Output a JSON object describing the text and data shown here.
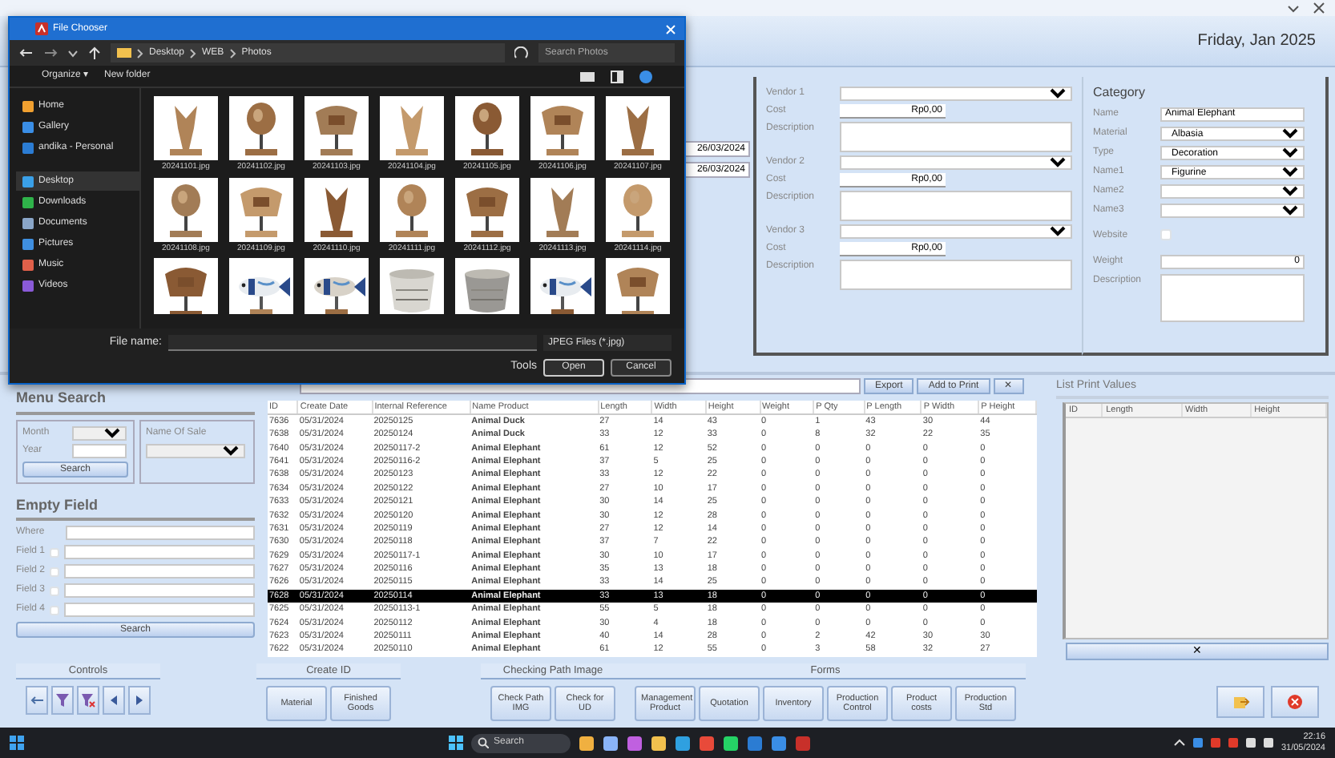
{
  "header": {
    "date": "Friday, Jan 2025"
  },
  "side_dates": [
    "26/03/2024",
    "26/03/2024"
  ],
  "vendors": [
    {
      "label": "Vendor 1",
      "cost_label": "Cost",
      "cost": "Rp0,00",
      "description_label": "Description"
    },
    {
      "label": "Vendor 2",
      "cost_label": "Cost",
      "cost": "Rp0,00",
      "description_label": "Description"
    },
    {
      "label": "Vendor 3",
      "cost_label": "Cost",
      "cost": "Rp0,00",
      "description_label": "Description"
    }
  ],
  "category": {
    "title": "Category",
    "fields": [
      {
        "label": "Name",
        "kind": "text",
        "value": "Animal Elephant"
      },
      {
        "label": "Material",
        "kind": "select",
        "value": "Albasia"
      },
      {
        "label": "Type",
        "kind": "select",
        "value": "Decoration"
      },
      {
        "label": "Name1",
        "kind": "select",
        "value": "Figurine"
      },
      {
        "label": "Name2",
        "kind": "select"
      },
      {
        "label": "Name3",
        "kind": "select"
      },
      {
        "label": "Website",
        "kind": "checkbox",
        "checked": false
      },
      {
        "label": "Weight",
        "kind": "spin",
        "value": "0"
      },
      {
        "label": "Description",
        "kind": "area"
      }
    ]
  },
  "menu_search": {
    "title": "Menu Search",
    "month_label": "Month",
    "year_label": "Year",
    "search_button": "Search",
    "name_label": "Name Of Sale"
  },
  "empty_field": {
    "title": "Empty Field",
    "where_label": "Where",
    "search_button": "Search",
    "fields": [
      {
        "label": "Field 1",
        "checked": false
      },
      {
        "label": "Field 2",
        "checked": false
      },
      {
        "label": "Field 3",
        "checked": false
      },
      {
        "label": "Field 4",
        "checked": false
      }
    ]
  },
  "table": {
    "buttons": [
      "Export",
      "Add to Print",
      "✕"
    ],
    "columns": [
      "ID",
      "Create Date",
      "Internal Reference",
      "Name Product",
      "Length",
      "Width",
      "Height",
      "Weight",
      "P Qty",
      "P Length",
      "P Width",
      "P Height"
    ],
    "rows": [
      {
        "selected": false,
        "cells": [
          "7636",
          "05/31/2024",
          "20250125",
          "Animal Duck",
          "27",
          "14",
          "43",
          "0",
          "1",
          "43",
          "30",
          "44"
        ]
      },
      {
        "selected": false,
        "cells": [
          "7638",
          "05/31/2024",
          "20250124",
          "Animal Duck",
          "33",
          "12",
          "33",
          "0",
          "8",
          "32",
          "22",
          "35"
        ]
      },
      {
        "selected": false,
        "cells": [
          "7640",
          "05/31/2024",
          "20250117-2",
          "Animal Elephant",
          "61",
          "12",
          "52",
          "0",
          "0",
          "0",
          "0",
          "0"
        ]
      },
      {
        "selected": false,
        "cells": [
          "7641",
          "05/31/2024",
          "20250116-2",
          "Animal Elephant",
          "37",
          "5",
          "25",
          "0",
          "0",
          "0",
          "0",
          "0"
        ]
      },
      {
        "selected": false,
        "cells": [
          "7638",
          "05/31/2024",
          "20250123",
          "Animal Elephant",
          "33",
          "12",
          "22",
          "0",
          "0",
          "0",
          "0",
          "0"
        ]
      },
      {
        "selected": false,
        "cells": [
          "7634",
          "05/31/2024",
          "20250122",
          "Animal Elephant",
          "27",
          "10",
          "17",
          "0",
          "0",
          "0",
          "0",
          "0"
        ]
      },
      {
        "selected": false,
        "cells": [
          "7633",
          "05/31/2024",
          "20250121",
          "Animal Elephant",
          "30",
          "14",
          "25",
          "0",
          "0",
          "0",
          "0",
          "0"
        ]
      },
      {
        "selected": false,
        "cells": [
          "7632",
          "05/31/2024",
          "20250120",
          "Animal Elephant",
          "30",
          "12",
          "28",
          "0",
          "0",
          "0",
          "0",
          "0"
        ]
      },
      {
        "selected": false,
        "cells": [
          "7631",
          "05/31/2024",
          "20250119",
          "Animal Elephant",
          "27",
          "12",
          "14",
          "0",
          "0",
          "0",
          "0",
          "0"
        ]
      },
      {
        "selected": false,
        "cells": [
          "7630",
          "05/31/2024",
          "20250118",
          "Animal Elephant",
          "37",
          "7",
          "22",
          "0",
          "0",
          "0",
          "0",
          "0"
        ]
      },
      {
        "selected": false,
        "cells": [
          "7629",
          "05/31/2024",
          "20250117-1",
          "Animal Elephant",
          "30",
          "10",
          "17",
          "0",
          "0",
          "0",
          "0",
          "0"
        ]
      },
      {
        "selected": false,
        "cells": [
          "7627",
          "05/31/2024",
          "20250116",
          "Animal Elephant",
          "35",
          "13",
          "18",
          "0",
          "0",
          "0",
          "0",
          "0"
        ]
      },
      {
        "selected": false,
        "cells": [
          "7626",
          "05/31/2024",
          "20250115",
          "Animal Elephant",
          "33",
          "14",
          "25",
          "0",
          "0",
          "0",
          "0",
          "0"
        ]
      },
      {
        "selected": true,
        "cells": [
          "7628",
          "05/31/2024",
          "20250114",
          "Animal Elephant",
          "33",
          "13",
          "18",
          "0",
          "0",
          "0",
          "0",
          "0"
        ]
      },
      {
        "selected": false,
        "cells": [
          "7625",
          "05/31/2024",
          "20250113-1",
          "Animal Elephant",
          "55",
          "5",
          "18",
          "0",
          "0",
          "0",
          "0",
          "0"
        ]
      },
      {
        "selected": false,
        "cells": [
          "7624",
          "05/31/2024",
          "20250112",
          "Animal Elephant",
          "30",
          "4",
          "18",
          "0",
          "0",
          "0",
          "0",
          "0"
        ]
      },
      {
        "selected": false,
        "cells": [
          "7623",
          "05/31/2024",
          "20250111",
          "Animal Elephant",
          "40",
          "14",
          "28",
          "0",
          "2",
          "42",
          "30",
          "30"
        ]
      },
      {
        "selected": false,
        "cells": [
          "7622",
          "05/31/2024",
          "20250110",
          "Animal Elephant",
          "61",
          "12",
          "55",
          "0",
          "3",
          "58",
          "32",
          "27"
        ]
      }
    ]
  },
  "print_list": {
    "title": "List Print Values",
    "columns": [
      "ID",
      "Length",
      "Width",
      "Height"
    ],
    "clear_button": "✕"
  },
  "toolbar": {
    "groups": [
      {
        "title": "Controls",
        "kind": "icons"
      },
      {
        "title": "Create ID",
        "kind": "buttons",
        "buttons": [
          "Material",
          "Finished Goods"
        ]
      },
      {
        "title": "Checking Path Image",
        "kind": "buttons",
        "buttons": [
          "Check Path IMG",
          "Check for UD"
        ]
      },
      {
        "title": "Forms",
        "kind": "buttons",
        "buttons": [
          "Management Product",
          "Quotation",
          "Inventory",
          "Production Control",
          "Product costs",
          "Production Std"
        ]
      }
    ]
  },
  "dialog": {
    "title": "File Chooser",
    "path": [
      "Desktop",
      "WEB",
      "Photos"
    ],
    "search_placeholder": "Search Photos",
    "organize": "Organize ▾",
    "new_folder": "New folder",
    "nav": [
      {
        "label": "Home",
        "color": "#f0a030",
        "selected": false
      },
      {
        "label": "Gallery",
        "color": "#3a8ee6",
        "selected": false
      },
      {
        "label": "andika - Personal",
        "color": "#2b7cd3",
        "selected": false
      },
      {
        "label": "Desktop",
        "color": "#3aa0e8",
        "selected": true
      },
      {
        "label": "Downloads",
        "color": "#2fb34a",
        "selected": false
      },
      {
        "label": "Documents",
        "color": "#8aa6c8",
        "selected": false
      },
      {
        "label": "Pictures",
        "color": "#3f8fe0",
        "selected": false
      },
      {
        "label": "Music",
        "color": "#e0604a",
        "selected": false
      },
      {
        "label": "Videos",
        "color": "#8a5ad8",
        "selected": false
      }
    ],
    "thumbnails": [
      {
        "name": "20241101.jpg"
      },
      {
        "name": "20241102.jpg"
      },
      {
        "name": "20241103.jpg"
      },
      {
        "name": "20241104.jpg"
      },
      {
        "name": "20241105.jpg"
      },
      {
        "name": "20241106.jpg"
      },
      {
        "name": "20241107.jpg"
      },
      {
        "name": "20241108.jpg"
      },
      {
        "name": "20241109.jpg"
      },
      {
        "name": "20241110.jpg"
      },
      {
        "name": "20241111.jpg"
      },
      {
        "name": "20241112.jpg"
      },
      {
        "name": "20241113.jpg"
      },
      {
        "name": "20241114.jpg"
      },
      {
        "kind": "picture"
      },
      {
        "kind": "picture"
      },
      {
        "kind": "picture"
      },
      {
        "kind": "picture"
      },
      {
        "kind": "picture"
      },
      {
        "kind": "picture"
      },
      {
        "kind": "picture"
      }
    ],
    "file_name_label": "File name:",
    "file_type": "JPEG Files (*.jpg)",
    "tools": "Tools",
    "open": "Open",
    "cancel": "Cancel"
  },
  "taskbar": {
    "search_placeholder": "Search",
    "time": "22:16",
    "date": "31/05/2024"
  }
}
